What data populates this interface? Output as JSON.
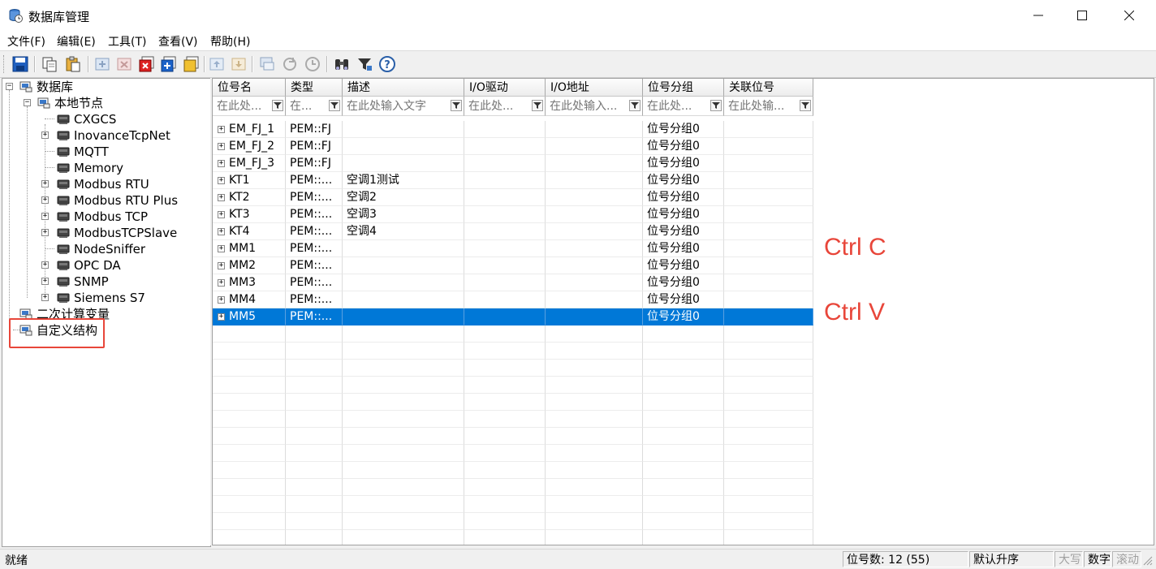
{
  "window": {
    "title": "数据库管理",
    "minimize": "—",
    "maximize": "☐",
    "close": "✕"
  },
  "menu": [
    {
      "label": "文件(F)"
    },
    {
      "label": "编辑(E)"
    },
    {
      "label": "工具(T)"
    },
    {
      "label": "查看(V)"
    },
    {
      "label": "帮助(H)"
    }
  ],
  "toolbar": {
    "icons": [
      "save-icon",
      "copy-icon",
      "paste-icon",
      "add-tag-icon",
      "delete-tag-icon",
      "delete-red-icon",
      "add-blue-icon",
      "edit-yellow-icon",
      "import-icon",
      "export-icon",
      "monitor-icon",
      "refresh-icon",
      "history-icon",
      "binoculars-icon",
      "filter-icon",
      "help-icon"
    ]
  },
  "tree": {
    "root": "数据库",
    "local": "本地节点",
    "drivers": [
      {
        "label": "CXGCS",
        "expandable": false
      },
      {
        "label": "InovanceTcpNet",
        "expandable": true
      },
      {
        "label": "MQTT",
        "expandable": false
      },
      {
        "label": "Memory",
        "expandable": false
      },
      {
        "label": "Modbus RTU",
        "expandable": true
      },
      {
        "label": "Modbus RTU Plus",
        "expandable": true
      },
      {
        "label": "Modbus TCP",
        "expandable": true
      },
      {
        "label": "ModbusTCPSlave",
        "expandable": true
      },
      {
        "label": "NodeSniffer",
        "expandable": false
      },
      {
        "label": "OPC DA",
        "expandable": true
      },
      {
        "label": "SNMP",
        "expandable": true
      },
      {
        "label": "Siemens S7",
        "expandable": true
      }
    ],
    "calc": "二次计算变量",
    "custom": "自定义结构"
  },
  "grid": {
    "columns": [
      {
        "label": "位号名",
        "filter": "在此处..."
      },
      {
        "label": "类型",
        "filter": "在..."
      },
      {
        "label": "描述",
        "filter": "在此处输入文字"
      },
      {
        "label": "I/O驱动",
        "filter": "在此处..."
      },
      {
        "label": "I/O地址",
        "filter": "在此处输入..."
      },
      {
        "label": "位号分组",
        "filter": "在此处..."
      },
      {
        "label": "关联位号",
        "filter": "在此处输..."
      }
    ],
    "rows": [
      {
        "name": "EM_FJ_1",
        "type": "PEM::FJ",
        "desc": "",
        "driver": "",
        "addr": "",
        "group": "位号分组0",
        "link": ""
      },
      {
        "name": "EM_FJ_2",
        "type": "PEM::FJ",
        "desc": "",
        "driver": "",
        "addr": "",
        "group": "位号分组0",
        "link": ""
      },
      {
        "name": "EM_FJ_3",
        "type": "PEM::FJ",
        "desc": "",
        "driver": "",
        "addr": "",
        "group": "位号分组0",
        "link": ""
      },
      {
        "name": "KT1",
        "type": "PEM::...",
        "desc": "空调1测试",
        "driver": "",
        "addr": "",
        "group": "位号分组0",
        "link": ""
      },
      {
        "name": "KT2",
        "type": "PEM::...",
        "desc": "空调2",
        "driver": "",
        "addr": "",
        "group": "位号分组0",
        "link": ""
      },
      {
        "name": "KT3",
        "type": "PEM::...",
        "desc": "空调3",
        "driver": "",
        "addr": "",
        "group": "位号分组0",
        "link": ""
      },
      {
        "name": "KT4",
        "type": "PEM::...",
        "desc": "空调4",
        "driver": "",
        "addr": "",
        "group": "位号分组0",
        "link": ""
      },
      {
        "name": "MM1",
        "type": "PEM::...",
        "desc": "",
        "driver": "",
        "addr": "",
        "group": "位号分组0",
        "link": ""
      },
      {
        "name": "MM2",
        "type": "PEM::...",
        "desc": "",
        "driver": "",
        "addr": "",
        "group": "位号分组0",
        "link": ""
      },
      {
        "name": "MM3",
        "type": "PEM::...",
        "desc": "",
        "driver": "",
        "addr": "",
        "group": "位号分组0",
        "link": ""
      },
      {
        "name": "MM4",
        "type": "PEM::...",
        "desc": "",
        "driver": "",
        "addr": "",
        "group": "位号分组0",
        "link": ""
      },
      {
        "name": "MM5",
        "type": "PEM::...",
        "desc": "",
        "driver": "",
        "addr": "",
        "group": "位号分组0",
        "link": "",
        "selected": true
      }
    ]
  },
  "annotations": {
    "copy": "Ctrl  C",
    "paste": "Ctrl  V",
    "highlight_color": "#e8463a"
  },
  "status": {
    "text": "就绪",
    "count": "位号数:  12  (55)",
    "sort": "默认升序",
    "caps": "大写",
    "num": "数字",
    "scroll": "滚动"
  },
  "colors": {
    "selection": "#0078d7",
    "annotation": "#e8463a"
  }
}
